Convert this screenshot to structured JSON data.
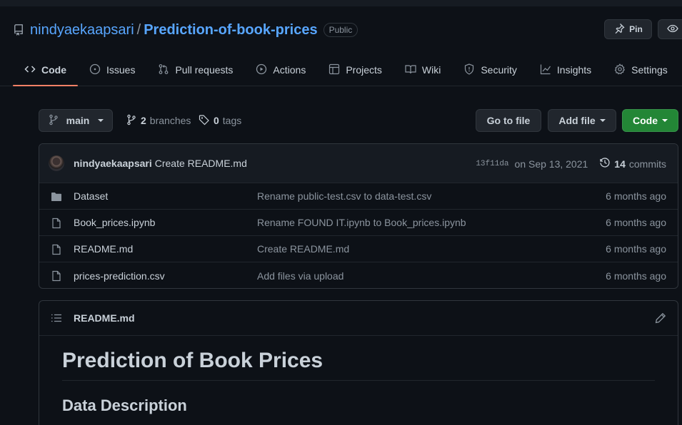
{
  "repo": {
    "owner": "nindyaekaapsari",
    "separator": "/",
    "name": "Prediction-of-book-prices",
    "visibility": "Public",
    "pin_label": "Pin"
  },
  "tabs": [
    {
      "label": "Code",
      "icon": "code-icon",
      "active": true
    },
    {
      "label": "Issues",
      "icon": "issue-icon"
    },
    {
      "label": "Pull requests",
      "icon": "pull-request-icon"
    },
    {
      "label": "Actions",
      "icon": "play-icon"
    },
    {
      "label": "Projects",
      "icon": "table-icon"
    },
    {
      "label": "Wiki",
      "icon": "book-icon"
    },
    {
      "label": "Security",
      "icon": "shield-icon"
    },
    {
      "label": "Insights",
      "icon": "graph-icon"
    },
    {
      "label": "Settings",
      "icon": "gear-icon"
    }
  ],
  "branchbar": {
    "branch": "main",
    "branches_count": "2",
    "branches_label": "branches",
    "tags_count": "0",
    "tags_label": "tags",
    "go_to_file": "Go to file",
    "add_file": "Add file",
    "code": "Code"
  },
  "latest_commit": {
    "author": "nindyaekaapsari",
    "message": "Create README.md",
    "sha": "13f11da",
    "date": "on Sep 13, 2021",
    "commits_count": "14",
    "commits_label": "commits"
  },
  "files": [
    {
      "name": "Dataset",
      "type": "directory",
      "message": "Rename public-test.csv to data-test.csv",
      "age": "6 months ago"
    },
    {
      "name": "Book_prices.ipynb",
      "type": "file",
      "message": "Rename FOUND IT.ipynb to Book_prices.ipynb",
      "age": "6 months ago"
    },
    {
      "name": "README.md",
      "type": "file",
      "message": "Create README.md",
      "age": "6 months ago"
    },
    {
      "name": "prices-prediction.csv",
      "type": "file",
      "message": "Add files via upload",
      "age": "6 months ago"
    }
  ],
  "readme": {
    "filename": "README.md",
    "heading1": "Prediction of Book Prices",
    "heading2": "Data Description"
  },
  "colors": {
    "background": "#0d1117",
    "link": "#58a6ff",
    "accent_tab": "#f78166",
    "green_button": "#238636",
    "border": "#30363d"
  }
}
